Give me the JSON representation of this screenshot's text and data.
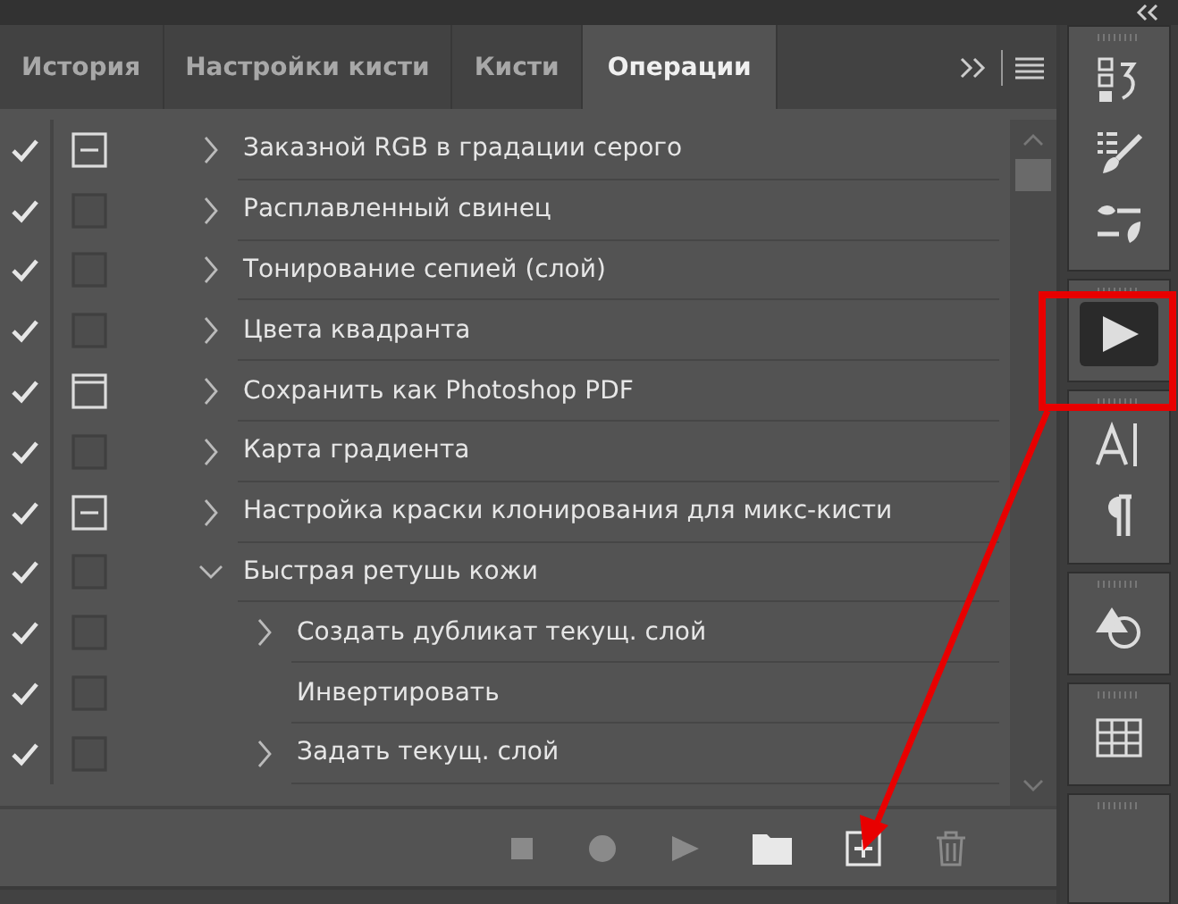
{
  "tabs": [
    {
      "label": "История",
      "selected": false
    },
    {
      "label": "Настройки кисти",
      "selected": false
    },
    {
      "label": "Кисти",
      "selected": false
    },
    {
      "label": "Операции",
      "selected": true
    }
  ],
  "actions": [
    {
      "name": "Заказной RGB в градации серого",
      "checked": true,
      "dialog": true,
      "dialog_partial": true,
      "expanded": false
    },
    {
      "name": "Расплавленный свинец",
      "checked": true,
      "dialog": false,
      "expanded": false
    },
    {
      "name": "Тонирование сепией (слой)",
      "checked": true,
      "dialog": false,
      "expanded": false
    },
    {
      "name": "Цвета квадранта",
      "checked": true,
      "dialog": false,
      "expanded": false
    },
    {
      "name": "Сохранить как Photoshop PDF",
      "checked": true,
      "dialog": true,
      "dialog_partial": false,
      "expanded": false
    },
    {
      "name": "Карта градиента",
      "checked": true,
      "dialog": false,
      "expanded": false
    },
    {
      "name": "Настройка краски клонирования для микс-кисти",
      "checked": true,
      "dialog": true,
      "dialog_partial": true,
      "expanded": false
    },
    {
      "name": "Быстрая ретушь кожи",
      "checked": true,
      "dialog": false,
      "expanded": true,
      "children": [
        {
          "name": "Создать дубликат текущ. слой",
          "checked": true,
          "dialog": false,
          "expanded": false
        },
        {
          "name": "Инвертировать",
          "checked": true,
          "dialog": false
        },
        {
          "name": "Задать текущ. слой",
          "checked": true,
          "dialog": false,
          "expanded": false
        }
      ]
    }
  ],
  "footer_buttons": [
    {
      "kind": "stop",
      "disabled": true
    },
    {
      "kind": "record",
      "disabled": true
    },
    {
      "kind": "play",
      "disabled": true
    },
    {
      "kind": "folder",
      "disabled": false
    },
    {
      "kind": "new",
      "disabled": false
    },
    {
      "kind": "delete",
      "disabled": true
    }
  ],
  "dock": [
    [
      {
        "kind": "history",
        "selected": false
      },
      {
        "kind": "brush-presets",
        "selected": false
      },
      {
        "kind": "brush-settings",
        "selected": false
      }
    ],
    [
      {
        "kind": "actions",
        "selected": true
      }
    ],
    [
      {
        "kind": "character",
        "selected": false
      },
      {
        "kind": "paragraph",
        "selected": false
      }
    ],
    [
      {
        "kind": "shapes",
        "selected": false
      }
    ],
    [
      {
        "kind": "table",
        "selected": false
      }
    ]
  ]
}
